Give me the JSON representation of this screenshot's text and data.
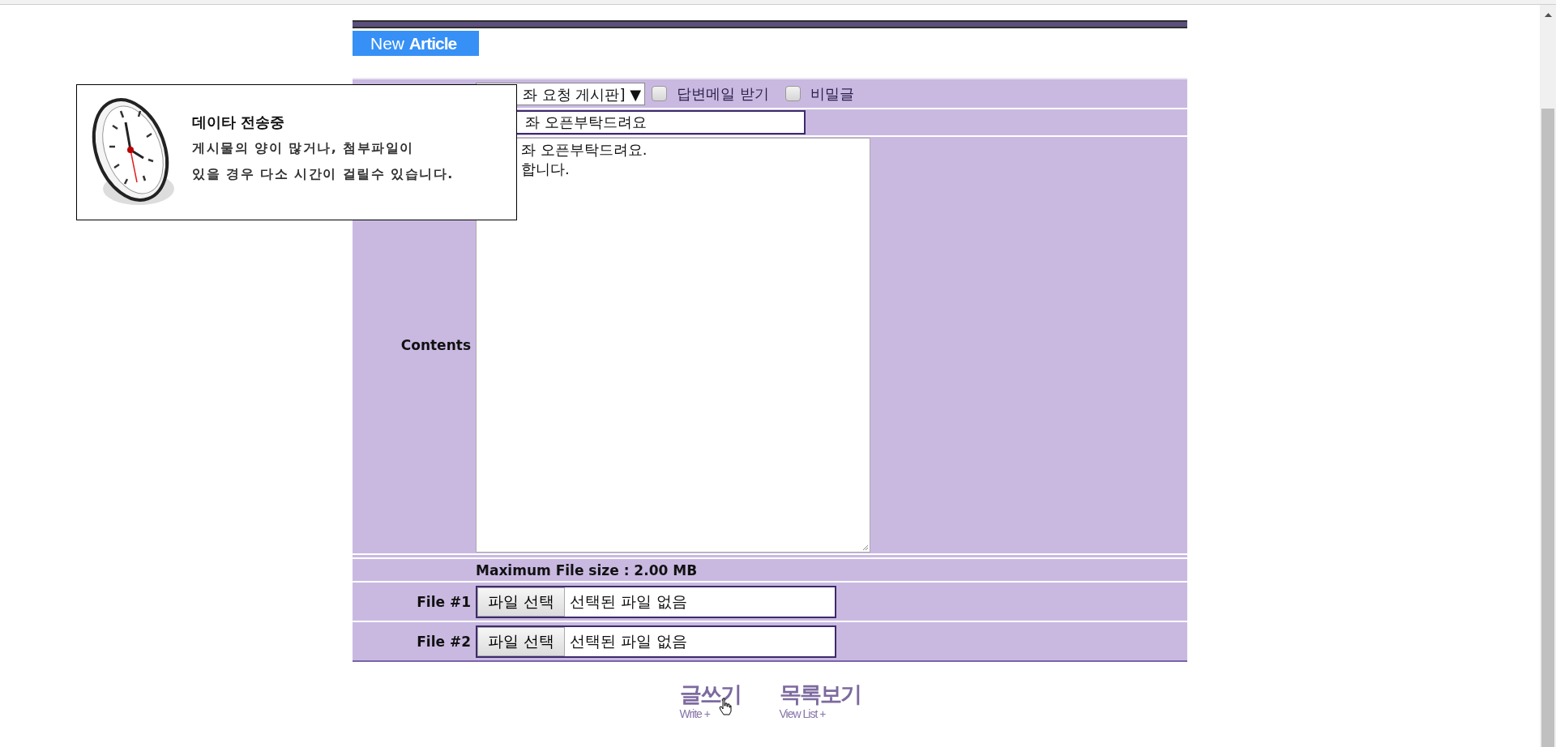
{
  "header": {
    "title_prefix": "New",
    "title_main": "Article"
  },
  "form": {
    "category_select": {
      "value": "좌 요청 게시판]",
      "arrow": "▼"
    },
    "options": [
      {
        "label": "답변메일 받기",
        "checked": false
      },
      {
        "label": "비밀글",
        "checked": false
      }
    ],
    "title_field": {
      "value": "좌 오픈부탁드려요"
    },
    "contents": {
      "label": "Contents",
      "value": "좌 오픈부탁드려요.\n합니다."
    },
    "max_file_size": "Maximum File size : 2.00 MB",
    "files": [
      {
        "label": "File #1",
        "button": "파일 선택",
        "status": "선택된 파일 없음"
      },
      {
        "label": "File #2",
        "button": "파일 선택",
        "status": "선택된 파일 없음"
      }
    ]
  },
  "actions": [
    {
      "label": "글쓰기",
      "sub": "Write +"
    },
    {
      "label": "목록보기",
      "sub": "View List +"
    }
  ],
  "popup": {
    "title": "데이타 전송중",
    "lines": [
      "게시물의 양이 많거나, 첨부파일이",
      "있을 경우 다소 시간이 걸릴수 있습니다."
    ]
  }
}
